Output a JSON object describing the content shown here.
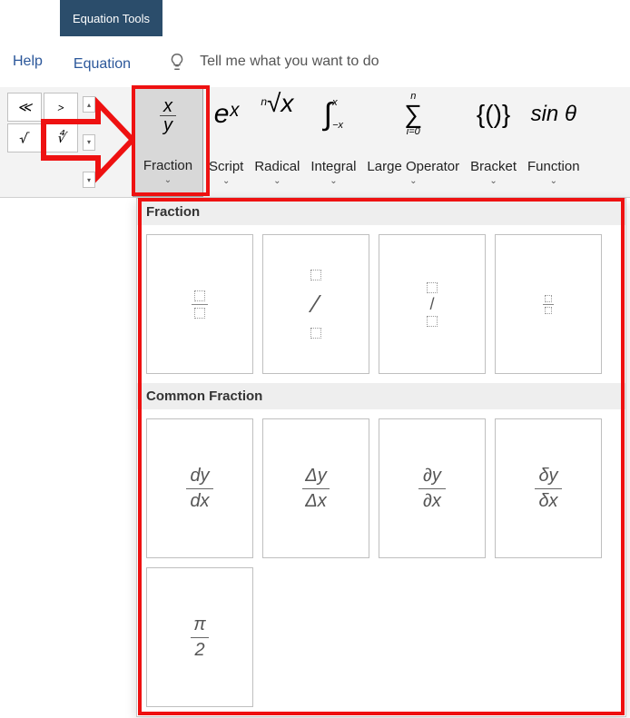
{
  "title_tab": "Equation Tools",
  "tabs": {
    "help": "Help",
    "equation": "Equation"
  },
  "tell_me": "Tell me what you want to do",
  "small_btns": {
    "a": "≪",
    "b": ">",
    "c": "√",
    "d": "∜"
  },
  "groups": {
    "fraction": "Fraction",
    "script": "Script",
    "radical": "Radical",
    "integral": "Integral",
    "large_op": "Large Operator",
    "bracket": "Bracket",
    "function": "Function"
  },
  "icons": {
    "frac_x": "x",
    "frac_y": "y",
    "script": "eˣ",
    "radical_n": "n",
    "radical_body": "√x",
    "integral_u": "x",
    "integral_l": "−x",
    "sum_u": "n",
    "sum_l": "i=0",
    "bracket": "{()}",
    "func": "sin θ"
  },
  "gallery": {
    "s1": "Fraction",
    "s2": "Common Fraction",
    "cf": {
      "a_n": "dy",
      "a_d": "dx",
      "b_n": "Δy",
      "b_d": "Δx",
      "c_n": "∂y",
      "c_d": "∂x",
      "d_n": "δy",
      "d_d": "δx",
      "e_n": "π",
      "e_d": "2"
    }
  }
}
